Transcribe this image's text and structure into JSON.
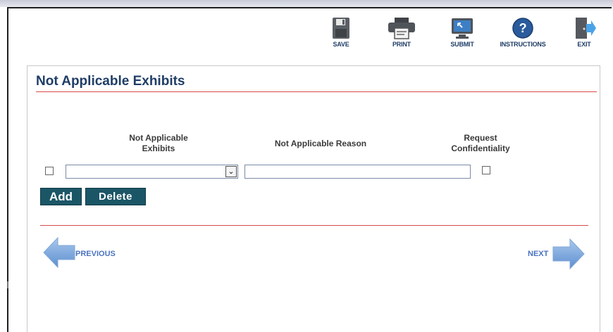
{
  "toolbar": {
    "save_label": "SAVE",
    "print_label": "PRINT",
    "submit_label": "SUBMIT",
    "instructions_label": "INSTRUCTIONS",
    "exit_label": "EXIT"
  },
  "panel": {
    "title": "Not Applicable Exhibits"
  },
  "table": {
    "columns": [
      "Not Applicable Exhibits",
      "Not Applicable Reason",
      "Request Confidentiality"
    ],
    "rows": [
      {
        "selected": false,
        "exhibit_value": "",
        "reason_value": "",
        "request_confidentiality": false
      }
    ]
  },
  "actions": {
    "add_label": "Add",
    "delete_label": "Delete"
  },
  "navigation": {
    "previous_label": "PREVIOUS",
    "next_label": "NEXT"
  }
}
